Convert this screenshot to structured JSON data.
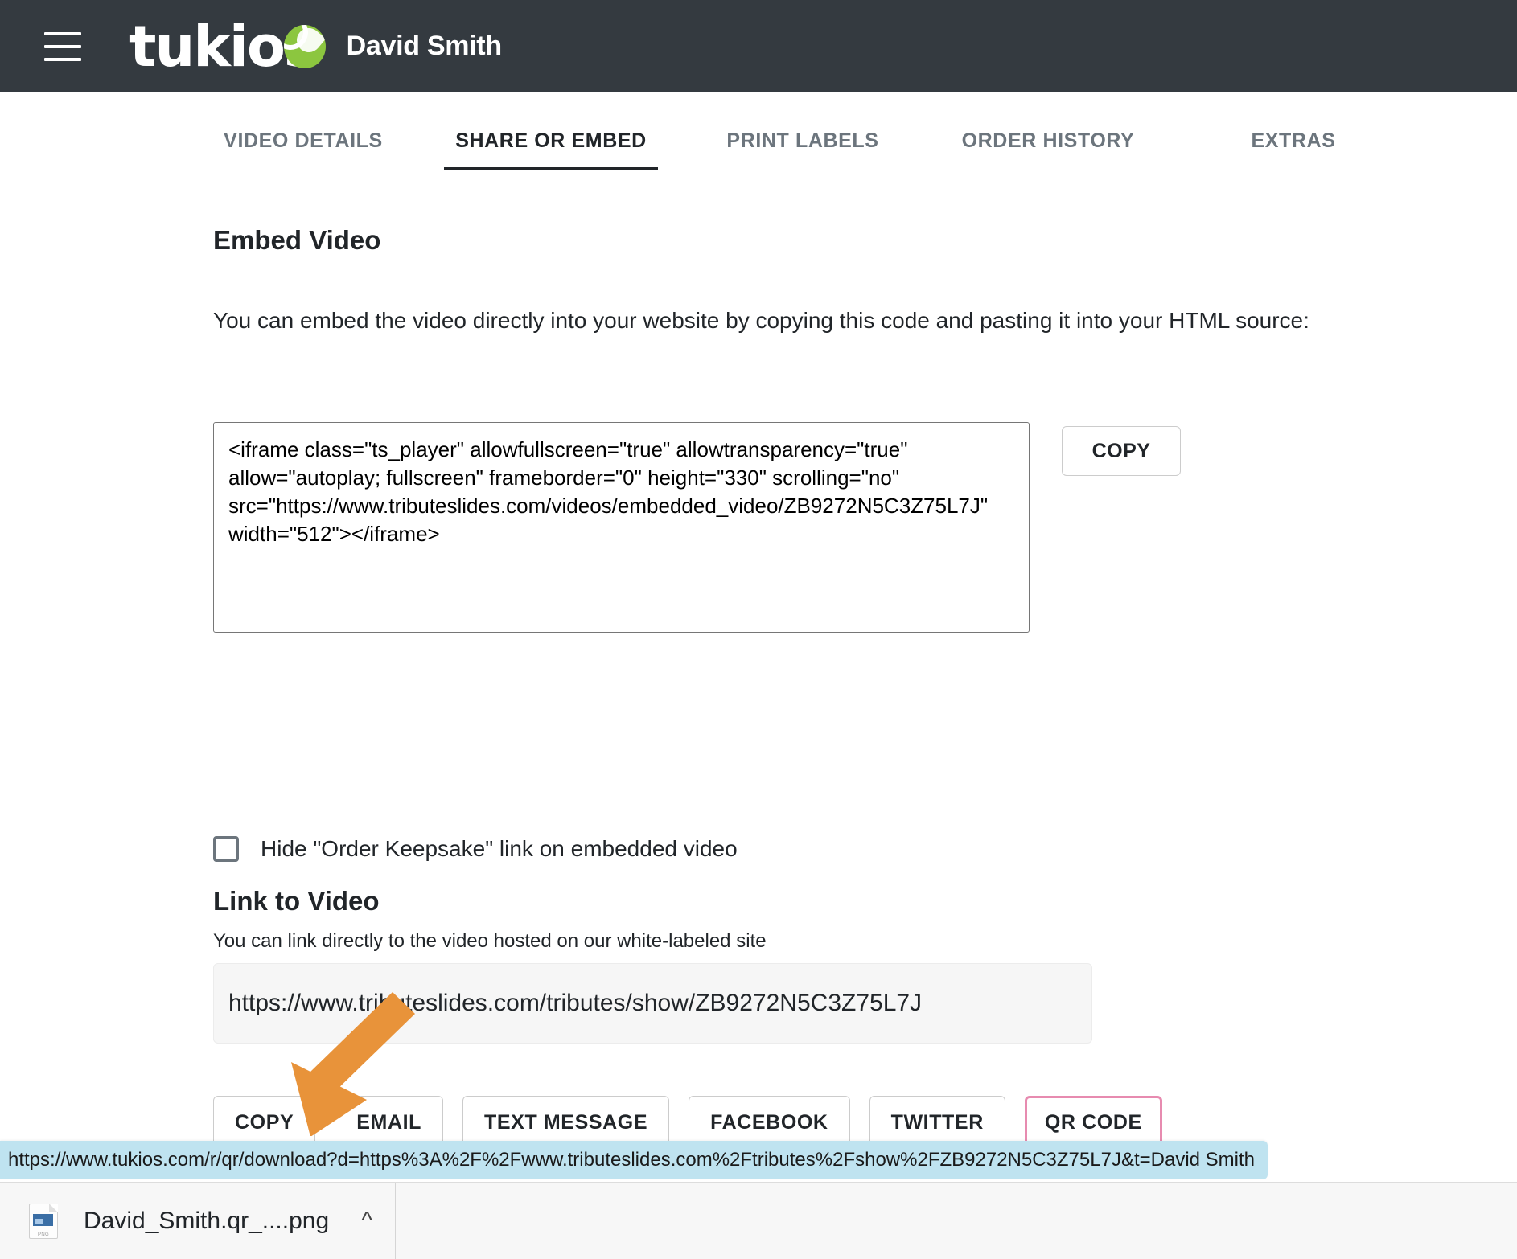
{
  "header": {
    "menu_icon": "hamburger-icon",
    "logo_text": "tukios",
    "user_name": "David Smith"
  },
  "tabs": [
    {
      "label": "VIDEO DETAILS",
      "active": false
    },
    {
      "label": "SHARE OR EMBED",
      "active": true
    },
    {
      "label": "PRINT LABELS",
      "active": false
    },
    {
      "label": "ORDER HISTORY",
      "active": false
    },
    {
      "label": "EXTRAS",
      "active": false
    }
  ],
  "embed": {
    "title": "Embed Video",
    "description": "You can embed the video directly into your website by copying this code and pasting it into your HTML source:",
    "code": "<iframe class=\"ts_player\" allowfullscreen=\"true\" allowtransparency=\"true\" allow=\"autoplay; fullscreen\" frameborder=\"0\" height=\"330\" scrolling=\"no\" src=\"https://www.tributeslides.com/videos/embedded_video/ZB9272N5C3Z75L7J\" width=\"512\"></iframe>",
    "copy_label": "COPY",
    "hide_keepsake_label": "Hide \"Order Keepsake\" link on embedded video",
    "hide_keepsake_checked": false
  },
  "link": {
    "title": "Link to Video",
    "description": "You can link directly to the video hosted on our white-labeled site",
    "url": "https://www.tributeslides.com/tributes/show/ZB9272N5C3Z75L7J"
  },
  "share_buttons": [
    {
      "label": "COPY",
      "highlighted": false
    },
    {
      "label": "EMAIL",
      "highlighted": false
    },
    {
      "label": "TEXT MESSAGE",
      "highlighted": false
    },
    {
      "label": "FACEBOOK",
      "highlighted": false
    },
    {
      "label": "TWITTER",
      "highlighted": false
    },
    {
      "label": "QR CODE",
      "highlighted": true
    }
  ],
  "annotation": {
    "arrow_icon": "arrow-down-left-icon",
    "arrow_color": "#e8933a"
  },
  "status_bar": {
    "url": "https://www.tukios.com/r/qr/download?d=https%3A%2F%2Fwww.tributeslides.com%2Ftributes%2Fshow%2FZB9272N5C3Z75L7J&t=David Smith"
  },
  "download_bar": {
    "file_name": "David_Smith.qr_....png",
    "file_type_label": "PNG",
    "chevron_icon": "chevron-up-icon"
  },
  "colors": {
    "header_bg": "#343a40",
    "logo_accent": "#8cc63f",
    "highlight_border": "#e78bb0",
    "annotation_orange": "#e8933a",
    "status_highlight": "#bfe3f0"
  }
}
